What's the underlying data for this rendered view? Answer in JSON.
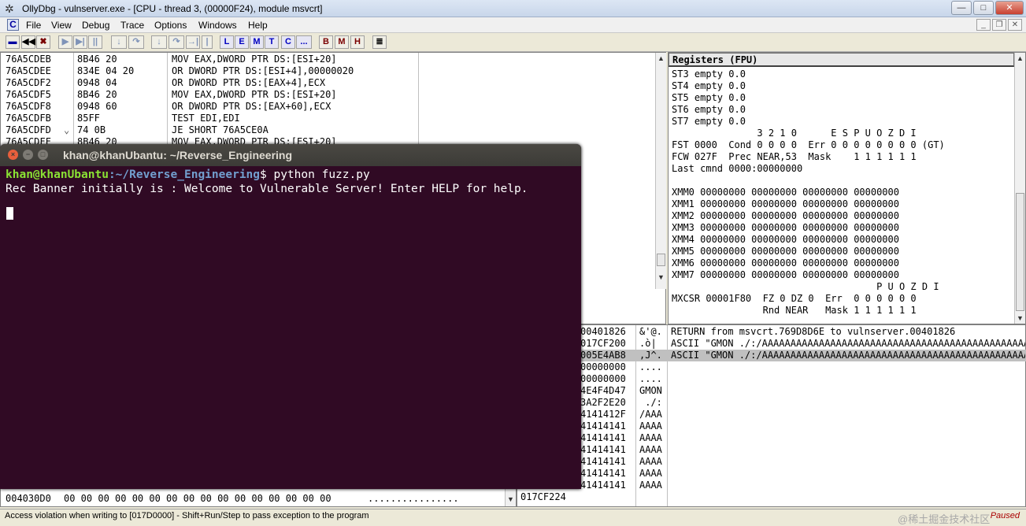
{
  "window": {
    "title": "OllyDbg - vulnserver.exe - [CPU - thread 3, (00000F24), module msvcrt]",
    "min": "—",
    "max": "□",
    "close": "✕"
  },
  "menu": [
    "C",
    "File",
    "View",
    "Debug",
    "Trace",
    "Options",
    "Windows",
    "Help"
  ],
  "toolbar": {
    "buttons": [
      "◀◀",
      "✖",
      "▶",
      "▶|",
      "||",
      "↓",
      "↷",
      "↓",
      "↷",
      "→|",
      "|",
      ""
    ],
    "letters": [
      "L",
      "E",
      "M",
      "T",
      "C",
      "...",
      "B",
      "M",
      "H",
      "≣"
    ]
  },
  "disasm": [
    {
      "addr": "76A5CDEB",
      "mark": "",
      "hex": "8B46 20",
      "instr": "MOV EAX,DWORD PTR DS:[ESI+20]"
    },
    {
      "addr": "76A5CDEE",
      "mark": "",
      "hex": "834E 04 20",
      "instr": "OR DWORD PTR DS:[ESI+4],00000020"
    },
    {
      "addr": "76A5CDF2",
      "mark": "",
      "hex": "0948 04",
      "instr": "OR DWORD PTR DS:[EAX+4],ECX"
    },
    {
      "addr": "76A5CDF5",
      "mark": "",
      "hex": "8B46 20",
      "instr": "MOV EAX,DWORD PTR DS:[ESI+20]"
    },
    {
      "addr": "76A5CDF8",
      "mark": "",
      "hex": "0948 60",
      "instr": "OR DWORD PTR DS:[EAX+60],ECX"
    },
    {
      "addr": "76A5CDFB",
      "mark": "",
      "hex": "85FF",
      "instr": "TEST EDI,EDI"
    },
    {
      "addr": "76A5CDFD",
      "mark": "⌄",
      "hex": "74 0B",
      "instr": "JE SHORT 76A5CE0A"
    },
    {
      "addr": "76A5CDFF",
      "mark": "",
      "hex": "8B46 20",
      "instr": "MOV EAX,DWORD PTR DS:[ESI+20]"
    }
  ],
  "registers": {
    "header": "Registers (FPU)",
    "lines": [
      "ST3 empty 0.0",
      "ST4 empty 0.0",
      "ST5 empty 0.0",
      "ST6 empty 0.0",
      "ST7 empty 0.0",
      "               3 2 1 0      E S P U O Z D I",
      "FST 0000  Cond 0 0 0 0  Err 0 0 0 0 0 0 0 0 (GT)",
      "FCW 027F  Prec NEAR,53  Mask    1 1 1 1 1 1",
      "Last cmnd 0000:00000000",
      "",
      "XMM0 00000000 00000000 00000000 00000000",
      "XMM1 00000000 00000000 00000000 00000000",
      "XMM2 00000000 00000000 00000000 00000000",
      "XMM3 00000000 00000000 00000000 00000000",
      "XMM4 00000000 00000000 00000000 00000000",
      "XMM5 00000000 00000000 00000000 00000000",
      "XMM6 00000000 00000000 00000000 00000000",
      "XMM7 00000000 00000000 00000000 00000000",
      "                                    P U O Z D I",
      "MXCSR 00001F80  FZ 0 DZ 0  Err  0 0 0 0 0 0",
      "                Rnd NEAR   Mask 1 1 1 1 1 1"
    ]
  },
  "stack": [
    {
      "val": "00401826",
      "ascii": "&'@.",
      "comment": "RETURN from msvcrt.769D8D6E to vulnserver.00401826"
    },
    {
      "val": "017CF200",
      "ascii": ".ò|",
      "comment": "ASCII \"GMON ./:/AAAAAAAAAAAAAAAAAAAAAAAAAAAAAAAAAAAAAAAAAAAAAAAAAAA"
    },
    {
      "val": "005E4AB8",
      "ascii": ",J^.",
      "comment": "ASCII \"GMON ./:/AAAAAAAAAAAAAAAAAAAAAAAAAAAAAAAAAAAAAAAAAAAAAAAAAAA"
    },
    {
      "val": "00000000",
      "ascii": "....",
      "comment": ""
    },
    {
      "val": "00000000",
      "ascii": "....",
      "comment": ""
    },
    {
      "val": "4E4F4D47",
      "ascii": "GMON",
      "comment": ""
    },
    {
      "val": "3A2F2E20",
      "ascii": " ./:",
      "comment": ""
    },
    {
      "val": "4141412F",
      "ascii": "/AAA",
      "comment": ""
    },
    {
      "val": "41414141",
      "ascii": "AAAA",
      "comment": ""
    },
    {
      "val": "41414141",
      "ascii": "AAAA",
      "comment": ""
    },
    {
      "val": "41414141",
      "ascii": "AAAA",
      "comment": ""
    },
    {
      "val": "41414141",
      "ascii": "AAAA",
      "comment": ""
    },
    {
      "val": "41414141",
      "ascii": "AAAA",
      "comment": ""
    },
    {
      "val": "41414141",
      "ascii": "AAAA",
      "comment": ""
    },
    {
      "val": "41414141",
      "ascii": "AAAA",
      "comment": ""
    }
  ],
  "dump_row": {
    "addr": "004030D0",
    "hex": "00 00 00 00 00 00 00 00 00 00 00 00 00 00 00 00",
    "ascii": "................"
  },
  "stack_bottom_addr": "017CF224",
  "terminal": {
    "title": "khan@khanUbantu: ~/Reverse_Engineering",
    "prompt_user": "khan@khanUbantu",
    "prompt_path": ":~/Reverse_Engineering",
    "command": "$ python fuzz.py",
    "output": "Rec Banner initially is : Welcome to Vulnerable Server! Enter HELP for help."
  },
  "status": {
    "message": "Access violation when writing to [017D0000] - Shift+Run/Step to pass exception to the program",
    "state": "Paused"
  },
  "watermark": "@稀土掘金技术社区",
  "colors": {
    "terminal_bg": "#300a24",
    "prompt_green": "#8ae234",
    "prompt_blue": "#729fcf",
    "selected_row": "#c0c0c0"
  }
}
